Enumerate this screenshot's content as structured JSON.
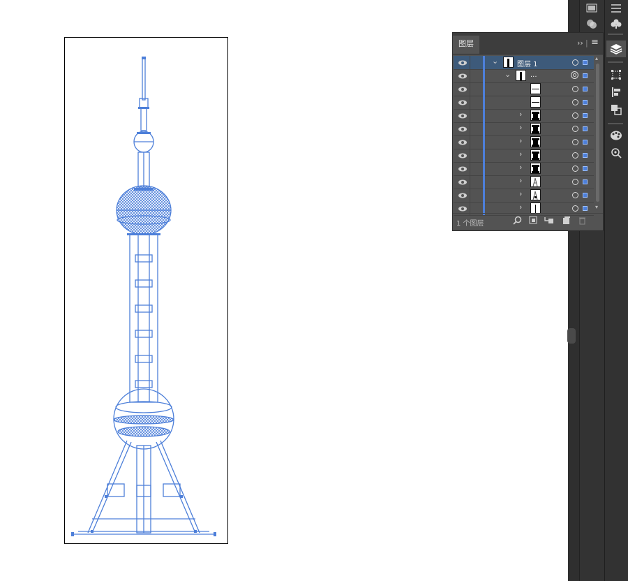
{
  "layers_panel": {
    "tab_title": "图层",
    "collapse_glyph": "››",
    "menu_glyph": "≡",
    "top_layer_name": "图层 1",
    "group_name": "...",
    "footer_count": "1 个图层",
    "layer_color": "#4d7fd9",
    "footer_icons": [
      "search-icon",
      "clip-mask-icon",
      "new-sublayer-icon",
      "new-layer-icon",
      "trash-icon"
    ]
  },
  "canvas": {
    "selection_color": "#4d7fd9"
  },
  "dock": {
    "tools": [
      "menu-icon",
      "club-icon",
      "layers-icon",
      "transform-icon",
      "align-icon",
      "pathfinder-icon",
      "color-guide-icon",
      "image-trace-icon"
    ],
    "col1_tools": [
      "gradient-icon",
      "transparency-icon"
    ]
  }
}
